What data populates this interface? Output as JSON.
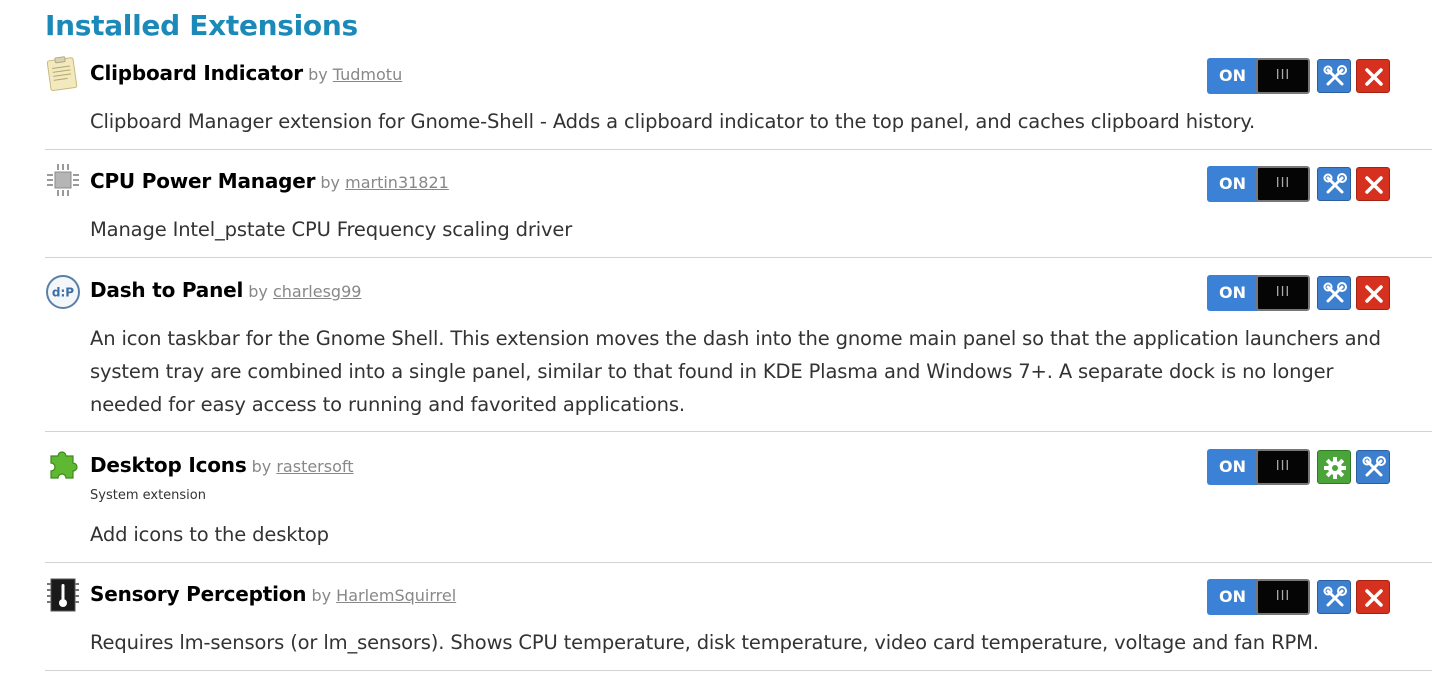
{
  "page": {
    "heading": "Installed Extensions"
  },
  "common": {
    "by_label": "by",
    "switch_on_label": "ON",
    "switch_off_label": "III"
  },
  "extensions": [
    {
      "name": "Clipboard Indicator",
      "author": "Tudmotu",
      "description": "Clipboard Manager extension for Gnome-Shell - Adds a clipboard indicator to the top panel, and caches clipboard history.",
      "icon": "clipboard-icon",
      "enabled": true
    },
    {
      "name": "CPU Power Manager",
      "author": "martin31821",
      "description": "Manage Intel_pstate CPU Frequency scaling driver",
      "icon": "cpu-chip-icon",
      "enabled": true
    },
    {
      "name": "Dash to Panel",
      "author": "charlesg99",
      "description": "An icon taskbar for the Gnome Shell. This extension moves the dash into the gnome main panel so that the application launchers and system tray are combined into a single panel, similar to that found in KDE Plasma and Windows 7+. A separate dock is no longer needed for easy access to running and favorited applications.",
      "icon": "dash-to-panel-icon",
      "enabled": true
    },
    {
      "name": "Desktop Icons",
      "author": "rastersoft",
      "system_label": "System extension",
      "description": "Add icons to the desktop",
      "icon": "puzzle-piece-icon",
      "enabled": true
    },
    {
      "name": "Sensory Perception",
      "author": "HarlemSquirrel",
      "description": "Requires lm-sensors (or lm_sensors). Shows CPU temperature, disk temperature, video card temperature, voltage and fan RPM.",
      "icon": "thermometer-chip-icon",
      "enabled": true
    }
  ],
  "colors": {
    "heading": "#1c8ab9",
    "switch_on": "#3b82d6",
    "settings_button": "#3d7fcf",
    "remove_button": "#d6301f",
    "system_settings_button": "#4aa43a"
  }
}
